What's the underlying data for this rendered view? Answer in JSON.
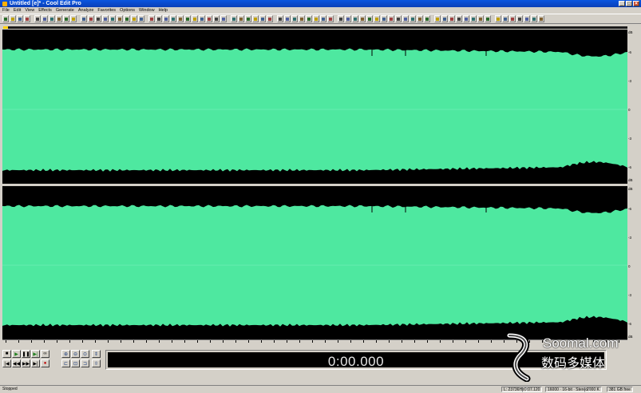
{
  "window": {
    "title": "Untitled [e]* - Cool Edit Pro",
    "minimize": "_",
    "maximize": "□",
    "close": "×"
  },
  "menu": [
    "File",
    "Edit",
    "View",
    "Effects",
    "Generate",
    "Analyze",
    "Favorites",
    "Options",
    "Window",
    "Help"
  ],
  "db_ruler_top": [
    "dB",
    "-6",
    "-3",
    "0",
    "-3",
    "-6",
    "dB"
  ],
  "time_display": "0:00.000",
  "status": {
    "state": "Stopped",
    "cells": [
      "L: 23736Hz",
      "0:07.120",
      "16000 · 16-bit · Stereo",
      "2000 K",
      "381 GB free"
    ]
  },
  "watermark": {
    "line1": "Soomal.com",
    "line2": "数码多媒体"
  },
  "colors": {
    "waveform": "#4ee8a0",
    "background": "#000000",
    "accent": "#0a4fd8"
  }
}
